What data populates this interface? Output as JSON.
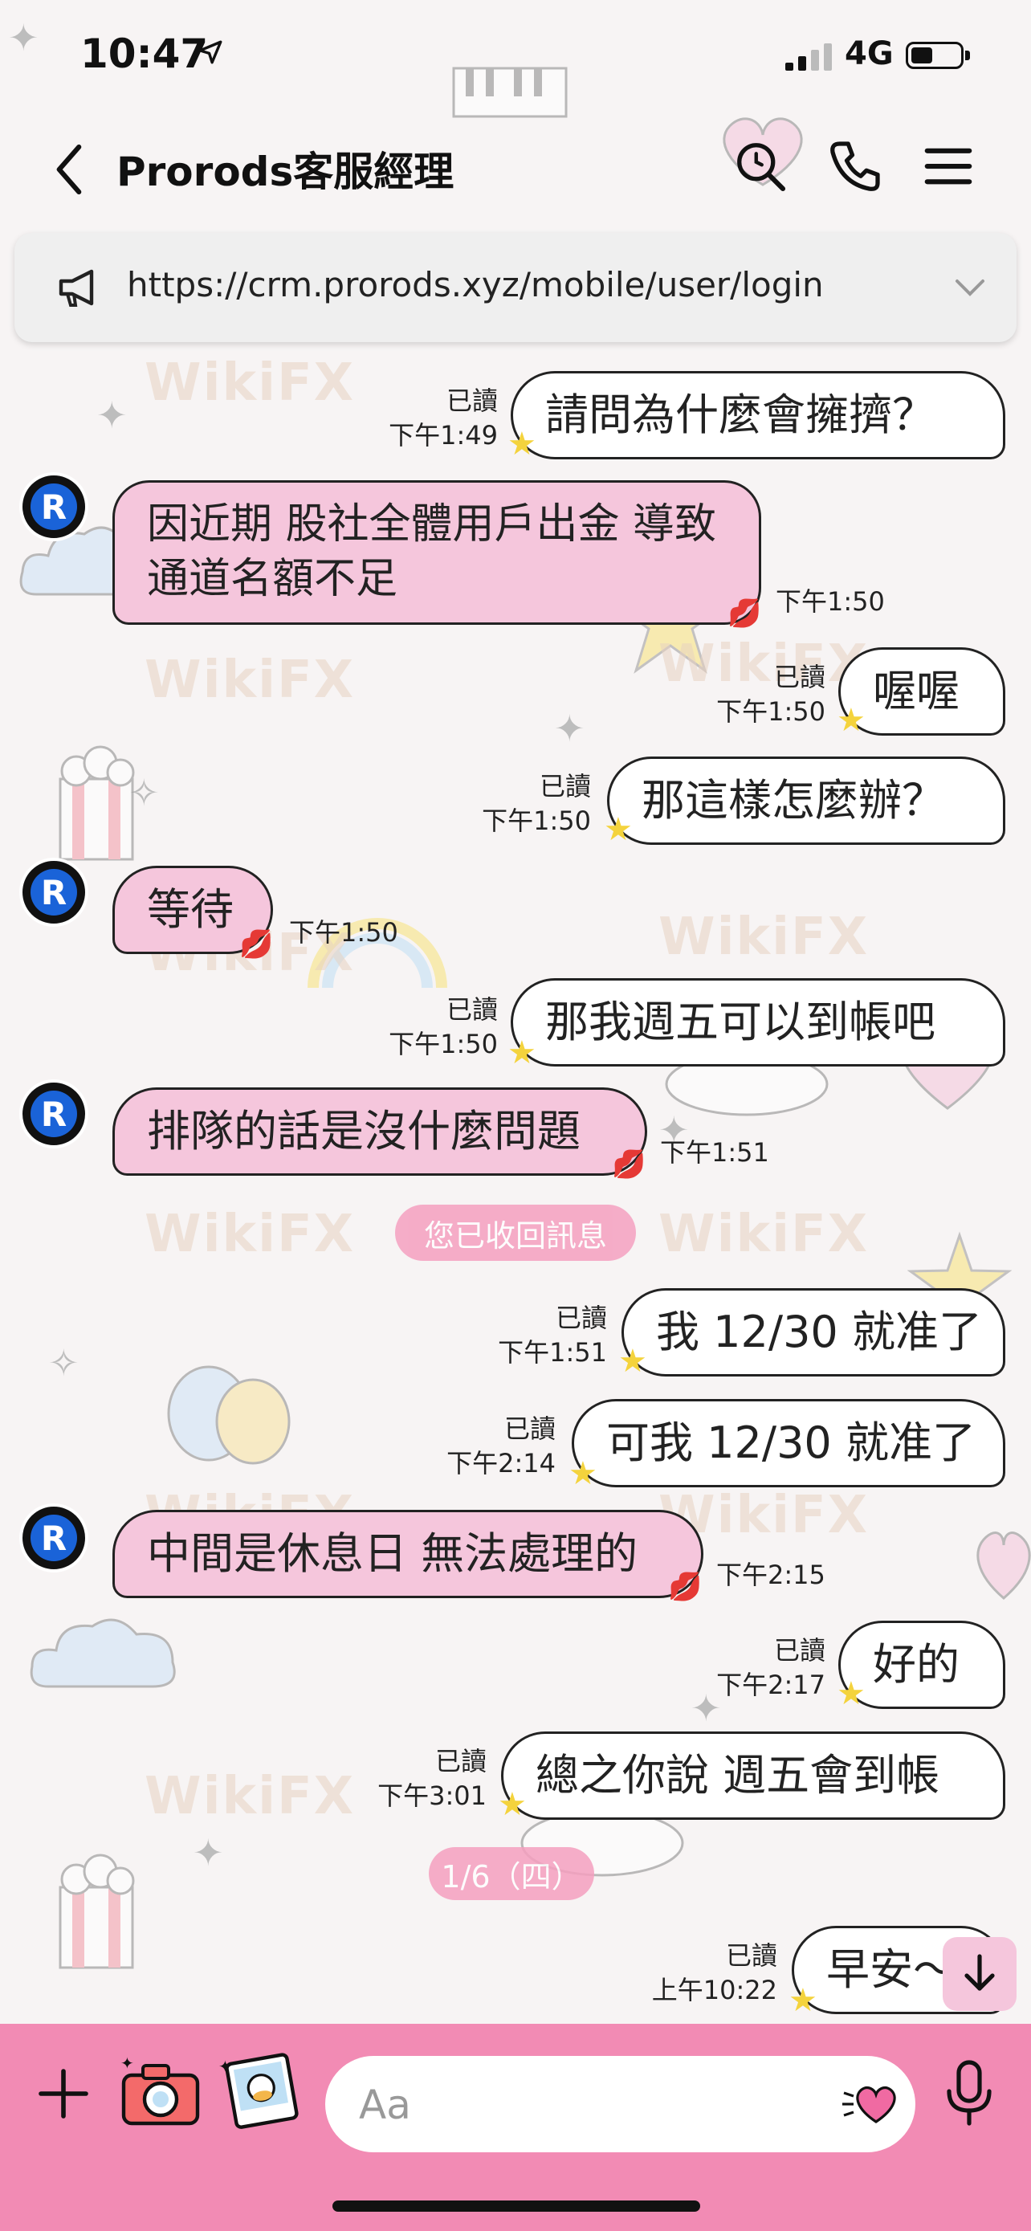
{
  "status_bar": {
    "time": "10:47",
    "network": "4G"
  },
  "header": {
    "title": "Prorods客服經理"
  },
  "banner": {
    "url": "https://crm.prorods.xyz/mobile/user/login"
  },
  "messages": [
    {
      "side": "me",
      "text": "請問為什麼會擁擠？",
      "read": "已讀",
      "time": "下午1:49"
    },
    {
      "side": "them",
      "text": "因近期 股社全體用戶出金 導致通道名額不足",
      "time": "下午1:50"
    },
    {
      "side": "me",
      "text": "喔喔",
      "read": "已讀",
      "time": "下午1:50"
    },
    {
      "side": "me",
      "text": "那這樣怎麼辦？",
      "read": "已讀",
      "time": "下午1:50"
    },
    {
      "side": "them",
      "text": "等待",
      "time": "下午1:50"
    },
    {
      "side": "me",
      "text": "那我週五可以到帳吧",
      "read": "已讀",
      "time": "下午1:50"
    },
    {
      "side": "them",
      "text": "排隊的話是沒什麼問題",
      "time": "下午1:51"
    },
    {
      "side": "me",
      "text": "我 12/30 就准了",
      "read": "已讀",
      "time": "下午1:51"
    },
    {
      "side": "me",
      "text": "可我 12/30 就准了",
      "read": "已讀",
      "time": "下午2:14"
    },
    {
      "side": "them",
      "text": "中間是休息日 無法處理的",
      "time": "下午2:15"
    },
    {
      "side": "me",
      "text": "好的",
      "read": "已讀",
      "time": "下午2:17"
    },
    {
      "side": "me",
      "text": "總之你說 週五會到帳",
      "read": "已讀",
      "time": "下午3:01"
    },
    {
      "side": "me",
      "text": "早安～",
      "read": "已讀",
      "time": "上午10:22"
    }
  ],
  "system": {
    "unsent": "您已收回訊息",
    "date_divider": "1/6（四）"
  },
  "avatar_letter": "R",
  "watermark": "WikiFX",
  "footer": {
    "input_placeholder": "Aa"
  },
  "icons": [
    "back-arrow-icon",
    "search-icon",
    "phone-icon",
    "menu-icon",
    "megaphone-icon",
    "chevron-down-icon",
    "plus-icon",
    "camera-icon",
    "photo-icon",
    "sticker-heart-icon",
    "microphone-icon",
    "scroll-down-arrow-icon"
  ],
  "colors": {
    "their_bubble": "#f5c6dc",
    "my_bubble": "#ffffff",
    "footer": "#f28bb4"
  }
}
